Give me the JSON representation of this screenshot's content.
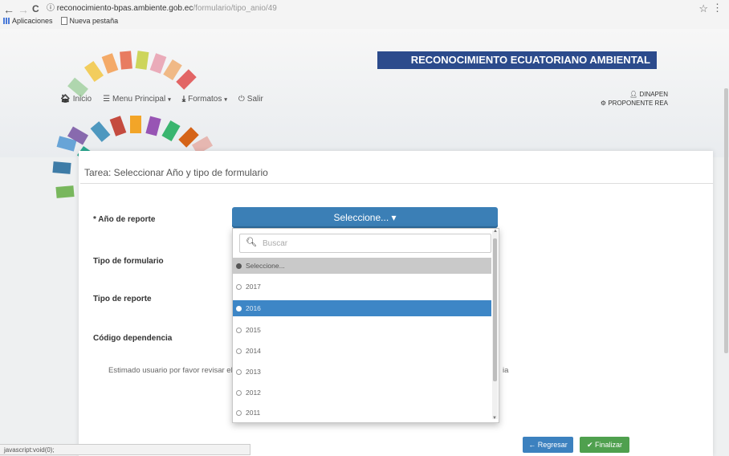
{
  "browser": {
    "back": "←",
    "forward": "→",
    "reload": "C",
    "info_icon": "ⓘ",
    "url_host": "reconocimiento-bpas.ambiente.gob.ec",
    "url_path": "/formulario/tipo_anio/49",
    "star": "☆",
    "menu": "⋮",
    "bookmarks": [
      "Aplicaciones",
      "Nueva pestaña"
    ]
  },
  "header": {
    "banner_title": "RECONOCIMIENTO ECUATORIANO AMBIENTAL",
    "nav": {
      "home": "Inicio",
      "main_menu": "Menu Principal",
      "formats": "Formatos",
      "logout": "Salir"
    },
    "user": {
      "name": "DINAPEN",
      "role": "PROPONENTE REA"
    }
  },
  "main": {
    "task_title": "Tarea: Seleccionar Año y tipo de formulario",
    "fields": {
      "year_label": "* Año de reporte",
      "form_type_label": "Tipo de formulario",
      "report_type_label": "Tipo de reporte",
      "dependency_label": "Código dependencia"
    },
    "note_start": "Estimado usuario por favor revisar el",
    "note_end": "ia",
    "select": {
      "button_label": "Seleccione... ▾",
      "search_placeholder": "Buscar",
      "options": [
        "Seleccione...",
        "2017",
        "2016",
        "2015",
        "2014",
        "2013",
        "2012",
        "2011"
      ],
      "highlighted": "2016"
    },
    "buttons": {
      "back": "← Regresar",
      "finish": "✔ Finalizar"
    }
  },
  "status_bar": "javascript:void(0);",
  "colors": {
    "primary": "#3b7fb6",
    "success": "#4fa04e",
    "banner": "#2c4b8c"
  }
}
